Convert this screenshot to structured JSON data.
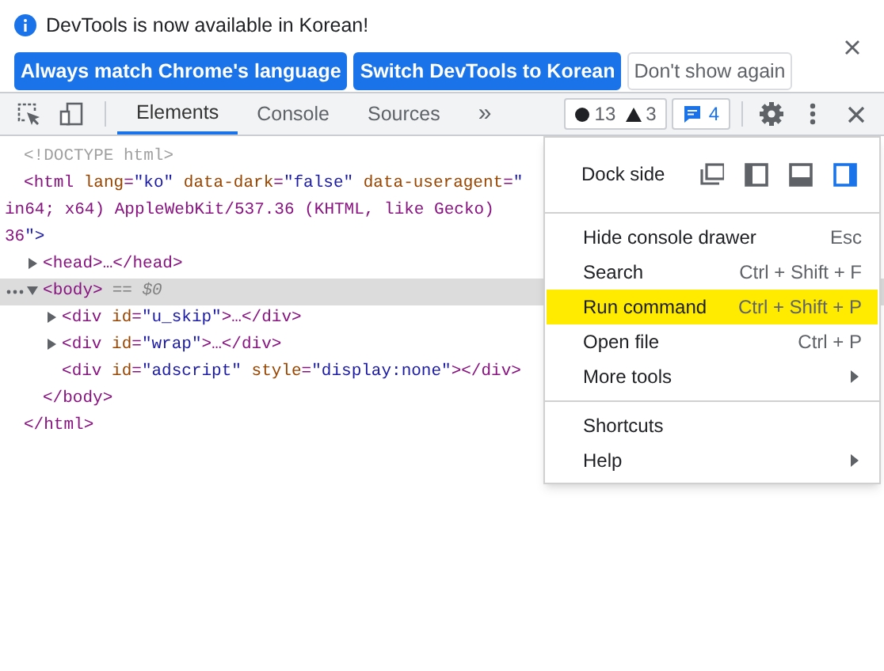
{
  "infobar": {
    "message": "DevTools is now available in Korean!",
    "buttons": [
      {
        "label": "Always match Chrome's language",
        "kind": "primary"
      },
      {
        "label": "Switch DevTools to Korean",
        "kind": "primary"
      },
      {
        "label": "Don't show again",
        "kind": "secondary"
      }
    ]
  },
  "toolbar": {
    "tabs": [
      {
        "label": "Elements",
        "selected": true
      },
      {
        "label": "Console",
        "selected": false
      },
      {
        "label": "Sources",
        "selected": false
      }
    ],
    "overflow": "»",
    "errors": "13",
    "warnings": "3",
    "messages": "4"
  },
  "dom_tree": [
    {
      "kind": "doctype",
      "text": "<!DOCTYPE html>"
    },
    {
      "kind": "element",
      "open_lines": [
        "<html lang=\"ko\" data-dark=\"false\" data-useragent=\"",
        "in64; x64) AppleWebKit/537.36 (KHTML, like Gecko)",
        "36\">"
      ],
      "close": "</html>",
      "children": [
        {
          "kind": "element",
          "open_lines": [
            "<head>…</head>"
          ],
          "expanded": false,
          "selected": false
        },
        {
          "kind": "element",
          "open_lines": [
            "<body>"
          ],
          "note": "== $0",
          "expanded": true,
          "selected": true,
          "close": "</body>",
          "children": [
            {
              "kind": "element",
              "open_lines": [
                "<div id=\"u_skip\">…</div>"
              ],
              "expanded": false,
              "selected": false
            },
            {
              "kind": "element",
              "open_lines": [
                "<div id=\"wrap\">…</div>"
              ],
              "expanded": false,
              "selected": false
            },
            {
              "kind": "element",
              "open_lines": [
                "<div id=\"adscript\" style=\"display:none\"></div>"
              ],
              "selected": false
            }
          ]
        }
      ]
    }
  ],
  "menu": {
    "dock_label": "Dock side",
    "dock_options": [
      {
        "kind": "undock",
        "selected": false
      },
      {
        "kind": "left",
        "selected": false
      },
      {
        "kind": "bottom",
        "selected": false
      },
      {
        "kind": "right",
        "selected": true
      }
    ],
    "groups": [
      [
        {
          "label": "Hide console drawer",
          "shortcut": "Esc",
          "highlighted": false
        },
        {
          "label": "Search",
          "shortcut": "Ctrl + Shift + F",
          "highlighted": false
        },
        {
          "label": "Run command",
          "shortcut": "Ctrl + Shift + P",
          "highlighted": true
        },
        {
          "label": "Open file",
          "shortcut": "Ctrl + P",
          "highlighted": false
        },
        {
          "label": "More tools",
          "submenu": true,
          "highlighted": false
        }
      ],
      [
        {
          "label": "Shortcuts",
          "highlighted": false
        },
        {
          "label": "Help",
          "submenu": true,
          "highlighted": false
        }
      ]
    ]
  }
}
